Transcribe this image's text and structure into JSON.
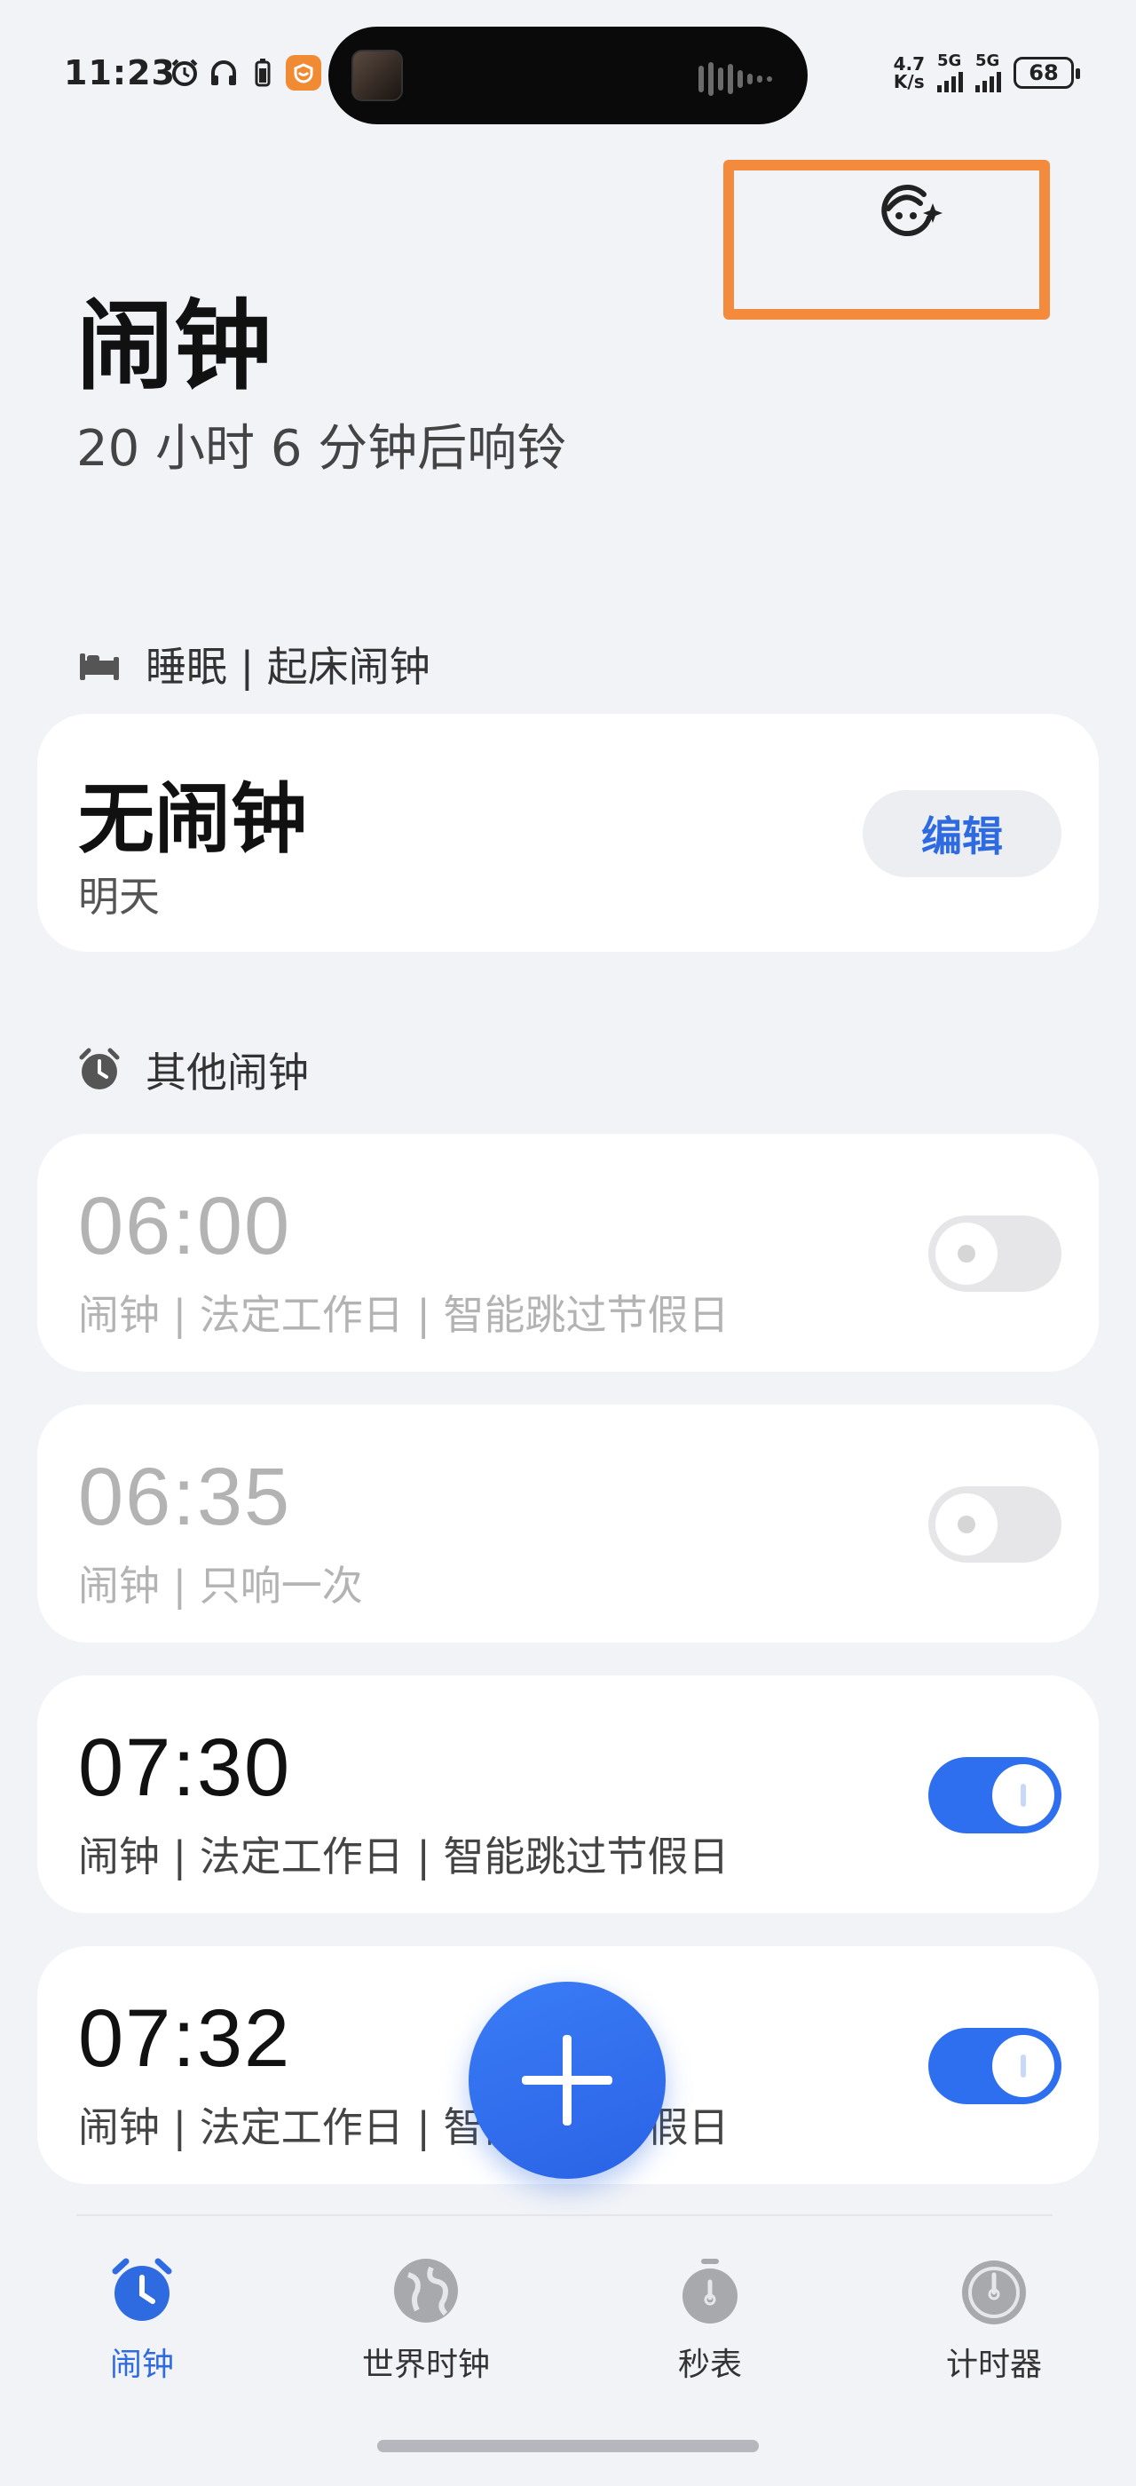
{
  "status_bar": {
    "time": "11:23",
    "net_speed_value": "4.7",
    "net_speed_unit": "K/s",
    "signal1_label": "5G",
    "signal2_label": "5G",
    "battery": "68"
  },
  "header": {
    "title": "闹钟",
    "subtitle": "20 小时 6 分钟后响铃"
  },
  "sleep_section": {
    "label": "睡眠 | 起床闹钟",
    "card_title": "无闹钟",
    "card_sub": "明天",
    "edit_label": "编辑"
  },
  "other_section": {
    "label": "其他闹钟"
  },
  "alarms": [
    {
      "time": "06:00",
      "desc": "闹钟 | 法定工作日 | 智能跳过节假日",
      "enabled": false
    },
    {
      "time": "06:35",
      "desc": "闹钟 | 只响一次",
      "enabled": false
    },
    {
      "time": "07:30",
      "desc": "闹钟 | 法定工作日 | 智能跳过节假日",
      "enabled": true
    },
    {
      "time": "07:32",
      "desc": "闹钟 | 法定工作日 | 智能跳过节假日",
      "enabled": true
    }
  ],
  "nav": {
    "items": [
      {
        "label": "闹钟",
        "icon": "alarm-clock-icon",
        "active": true
      },
      {
        "label": "世界时钟",
        "icon": "globe-icon",
        "active": false
      },
      {
        "label": "秒表",
        "icon": "stopwatch-icon",
        "active": false
      },
      {
        "label": "计时器",
        "icon": "timer-icon",
        "active": false
      }
    ]
  },
  "colors": {
    "accent": "#2e6be0",
    "highlight": "#f48b3c",
    "background": "#f1f3f7"
  }
}
